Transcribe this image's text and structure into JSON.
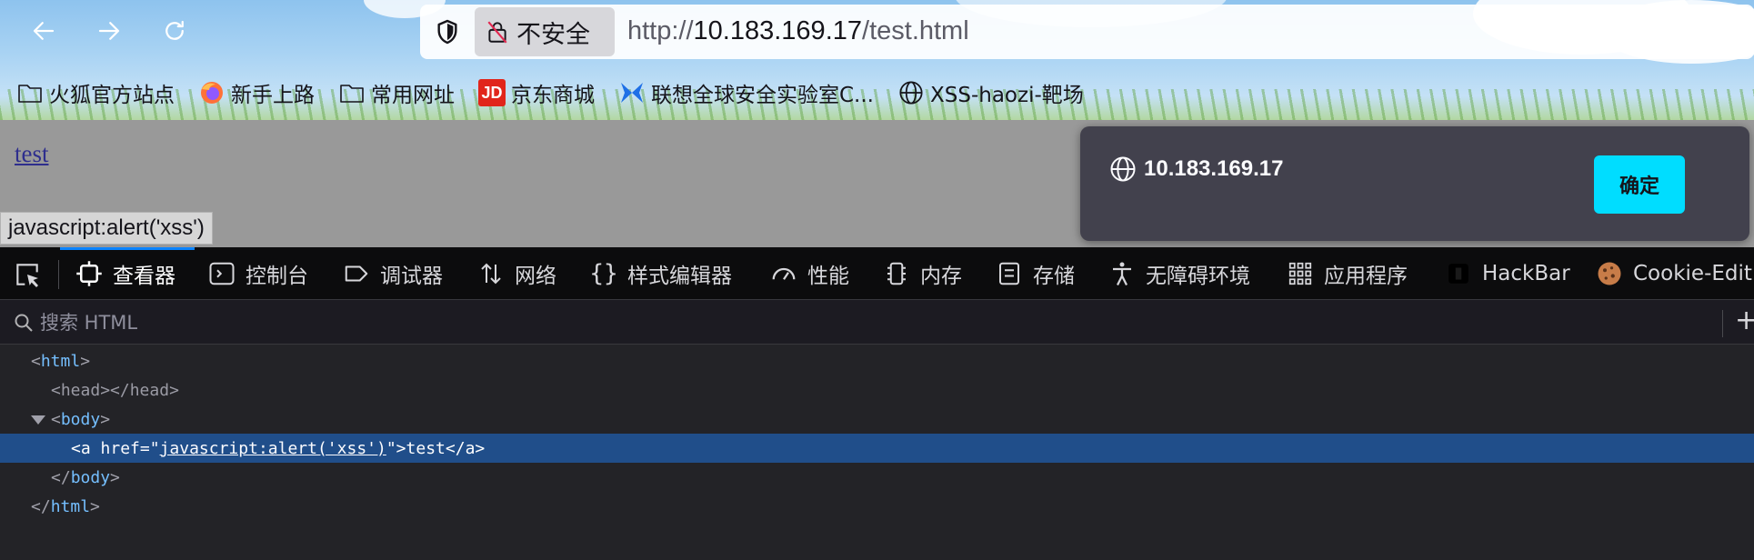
{
  "urlbar": {
    "security_label": "不安全",
    "url_prefix": "http://",
    "url_host": "10.183.169.17",
    "url_path": "/test.html"
  },
  "bookmarks": [
    {
      "label": "火狐官方站点",
      "icon": "folder-icon"
    },
    {
      "label": "新手上路",
      "icon": "firefox-icon"
    },
    {
      "label": "常用网址",
      "icon": "folder-icon"
    },
    {
      "label": "京东商城",
      "icon": "jd-logo-icon",
      "icon_text": "JD"
    },
    {
      "label": "联想全球安全实验室C...",
      "icon": "butterfly-logo-icon"
    },
    {
      "label": "XSS-haozi-靶场",
      "icon": "globe-icon"
    }
  ],
  "page": {
    "link_text": "test",
    "status_url": "javascript:alert('xss')"
  },
  "dialog": {
    "host": "10.183.169.17",
    "ok_label": "确定"
  },
  "devtools": {
    "tabs": [
      {
        "label": "查看器",
        "icon": "inspector-icon",
        "active": true
      },
      {
        "label": "控制台",
        "icon": "console-icon"
      },
      {
        "label": "调试器",
        "icon": "debugger-icon"
      },
      {
        "label": "网络",
        "icon": "network-icon"
      },
      {
        "label": "样式编辑器",
        "icon": "braces-icon"
      },
      {
        "label": "性能",
        "icon": "gauge-icon"
      },
      {
        "label": "内存",
        "icon": "memory-icon"
      },
      {
        "label": "存储",
        "icon": "storage-icon"
      },
      {
        "label": "无障碍环境",
        "icon": "accessibility-icon"
      },
      {
        "label": "应用程序",
        "icon": "grid-icon"
      },
      {
        "label": "HackBar",
        "icon": "hackbar-icon"
      },
      {
        "label": "Cookie-Edit",
        "icon": "cookie-icon"
      }
    ],
    "search_placeholder": "搜索 HTML",
    "add_label": "+",
    "tree": {
      "html_open": "html",
      "head_open": "head",
      "head_close": "head",
      "body_open": "body",
      "a_tag": "a",
      "a_attr": "href",
      "a_value": "javascript:alert('xss')",
      "a_text": "test",
      "body_close": "body",
      "html_close": "html"
    }
  },
  "colors": {
    "dialog_bg": "#42414d",
    "ok_button": "#00ddff",
    "selected_row": "#204e8a",
    "devtools_bg": "#232327"
  }
}
